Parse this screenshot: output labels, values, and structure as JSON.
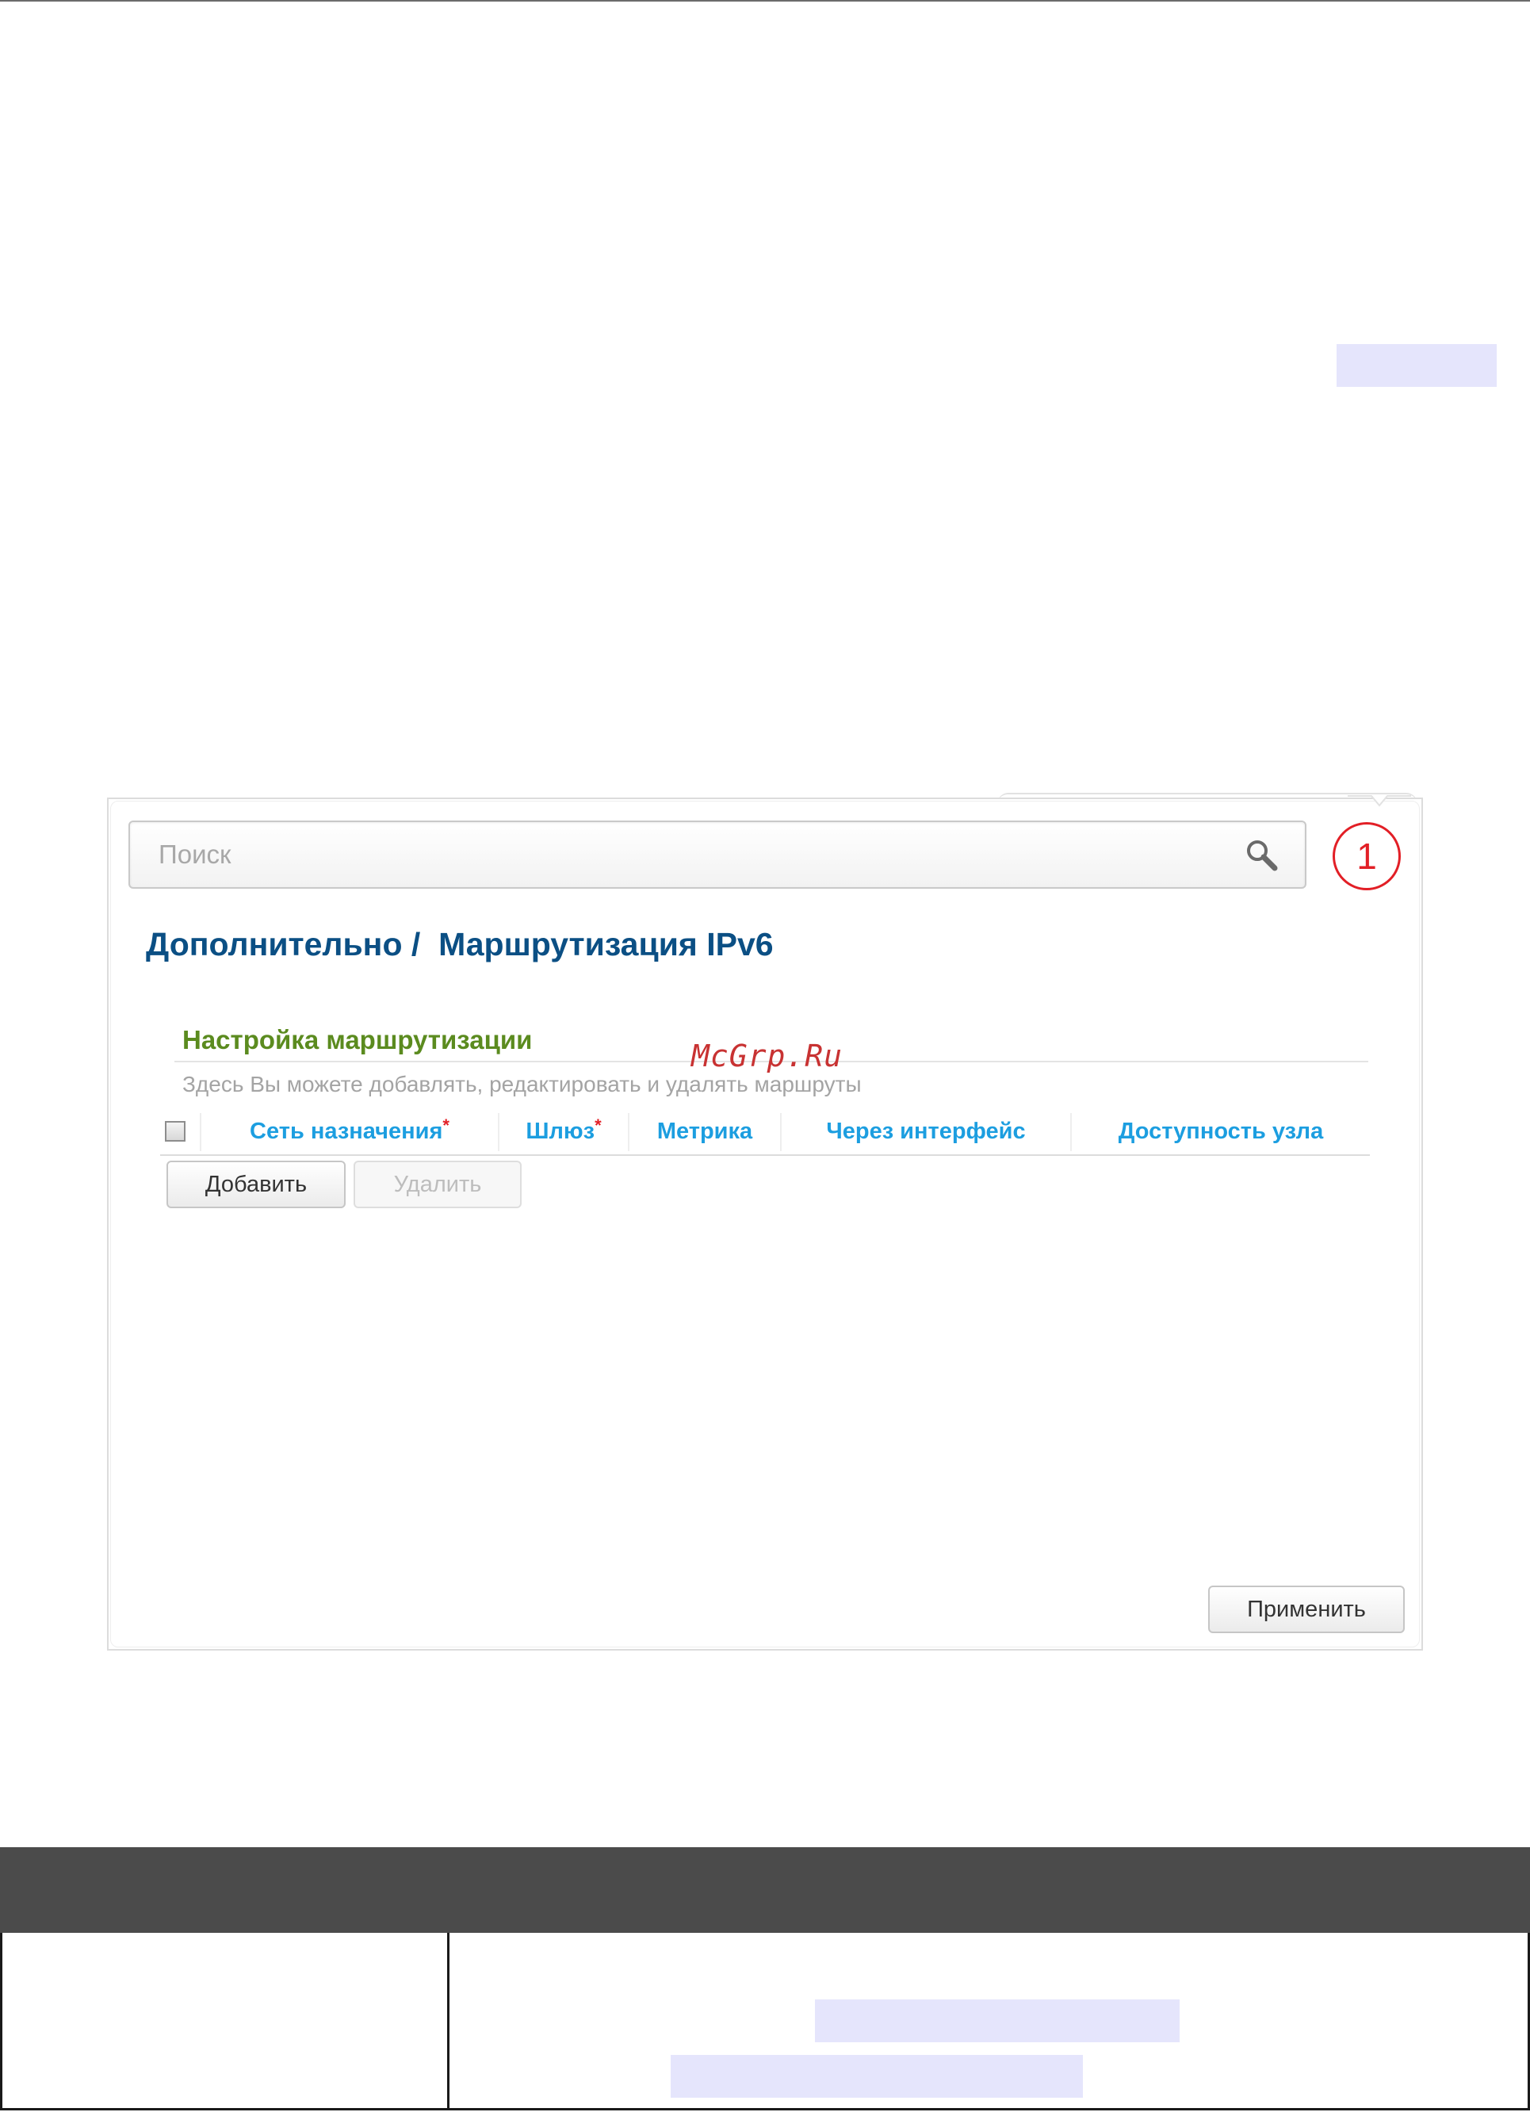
{
  "search": {
    "placeholder": "Поиск",
    "icon": "magnifier"
  },
  "callout": {
    "number": "1",
    "color": "#e21f26"
  },
  "breadcrumb": {
    "parent": "Дополнительно /",
    "current": "Маршрутизация IPv6"
  },
  "section": {
    "title": "Настройка маршрутизации",
    "description": "Здесь Вы можете добавлять, редактировать и удалять маршруты"
  },
  "watermark": "McGrp.Ru",
  "table": {
    "columns": [
      {
        "label": "Сеть назначения",
        "required": "*"
      },
      {
        "label": "Шлюз",
        "required": "*"
      },
      {
        "label": "Метрика",
        "required": ""
      },
      {
        "label": "Через интерфейс",
        "required": ""
      },
      {
        "label": "Доступность узла",
        "required": ""
      }
    ],
    "rows": []
  },
  "buttons": {
    "add": "Добавить",
    "delete": "Удалить",
    "apply": "Применить"
  },
  "colors": {
    "title": "#0b4f84",
    "section_title": "#5b8b1f",
    "column_header": "#1c9ee0",
    "required_mark": "#e21f26",
    "highlight": "#e5e5fc",
    "bottom_table_header": "#4b4b4b"
  }
}
